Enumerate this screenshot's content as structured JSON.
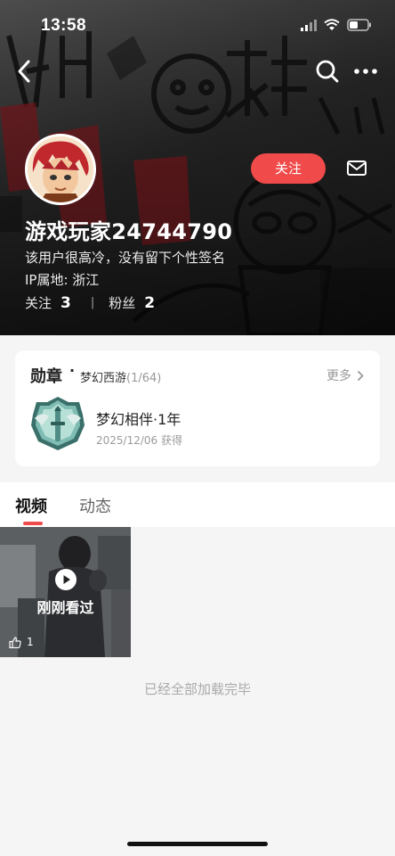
{
  "status_bar": {
    "time": "13:58"
  },
  "profile": {
    "name": "游戏玩家24744790",
    "signature": "该用户很高冷，没有留下个性签名",
    "ip_location": "IP属地: 浙江",
    "following_label": "关注",
    "following_count": "3",
    "fans_label": "粉丝",
    "fans_count": "2",
    "follow_button": "关注",
    "separator": "|"
  },
  "icons": {
    "back": "back-arrow-icon",
    "search": "search-icon",
    "more": "more-icon",
    "message": "mail-icon",
    "play": "play-icon",
    "like": "thumbs-up-icon",
    "chevron": "chevron-right-icon"
  },
  "medals": {
    "title": "勋章",
    "dot": "·",
    "game": "梦幻西游",
    "count": "(1/64)",
    "more": "更多",
    "item": {
      "name": "梦幻相伴·1年",
      "date": "2025/12/06 获得"
    }
  },
  "tabs": [
    {
      "label": "视频",
      "active": true
    },
    {
      "label": "动态",
      "active": false
    }
  ],
  "videos": [
    {
      "label": "刚刚看过",
      "likes": "1"
    }
  ],
  "end_text": "已经全部加载完毕",
  "colors": {
    "accent": "#f04a4a",
    "card": "#ffffff",
    "background": "#f5f5f5"
  }
}
